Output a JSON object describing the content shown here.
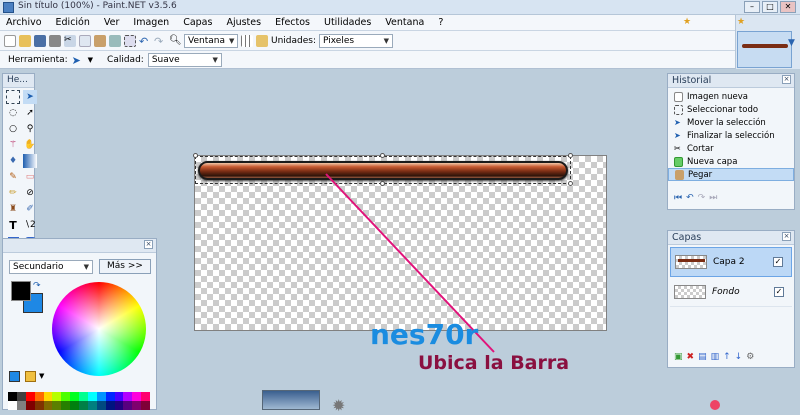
{
  "window": {
    "title": "Sin título (100%) - Paint.NET v3.5.6"
  },
  "menu": [
    "Archivo",
    "Edición",
    "Ver",
    "Imagen",
    "Capas",
    "Ajustes",
    "Efectos",
    "Utilidades",
    "Ventana",
    "?"
  ],
  "toolbar": {
    "zoom_value": "Ventana",
    "units_label": "Unidades:",
    "units_value": "Pixeles"
  },
  "toolbar2": {
    "tool_label": "Herramienta:",
    "quality_label": "Calidad:",
    "quality_value": "Suave"
  },
  "tools_panel": {
    "title": "He..."
  },
  "history": {
    "title": "Historial",
    "items": [
      "Imagen nueva",
      "Seleccionar todo",
      "Mover la selección",
      "Finalizar la selección",
      "Cortar",
      "Nueva capa",
      "Pegar"
    ]
  },
  "layers": {
    "title": "Capas",
    "items": [
      {
        "name": "Capa 2"
      },
      {
        "name": "Fondo"
      }
    ]
  },
  "colors": {
    "mode": "Secundario",
    "more_button": "Más >>",
    "primary": "#000000",
    "secondary": "#1e88e5"
  },
  "annotation": {
    "name": "nes70r",
    "instruction": "Ubica la Barra",
    "name_color": "#1a8ce0",
    "instruction_color": "#8a1040"
  }
}
